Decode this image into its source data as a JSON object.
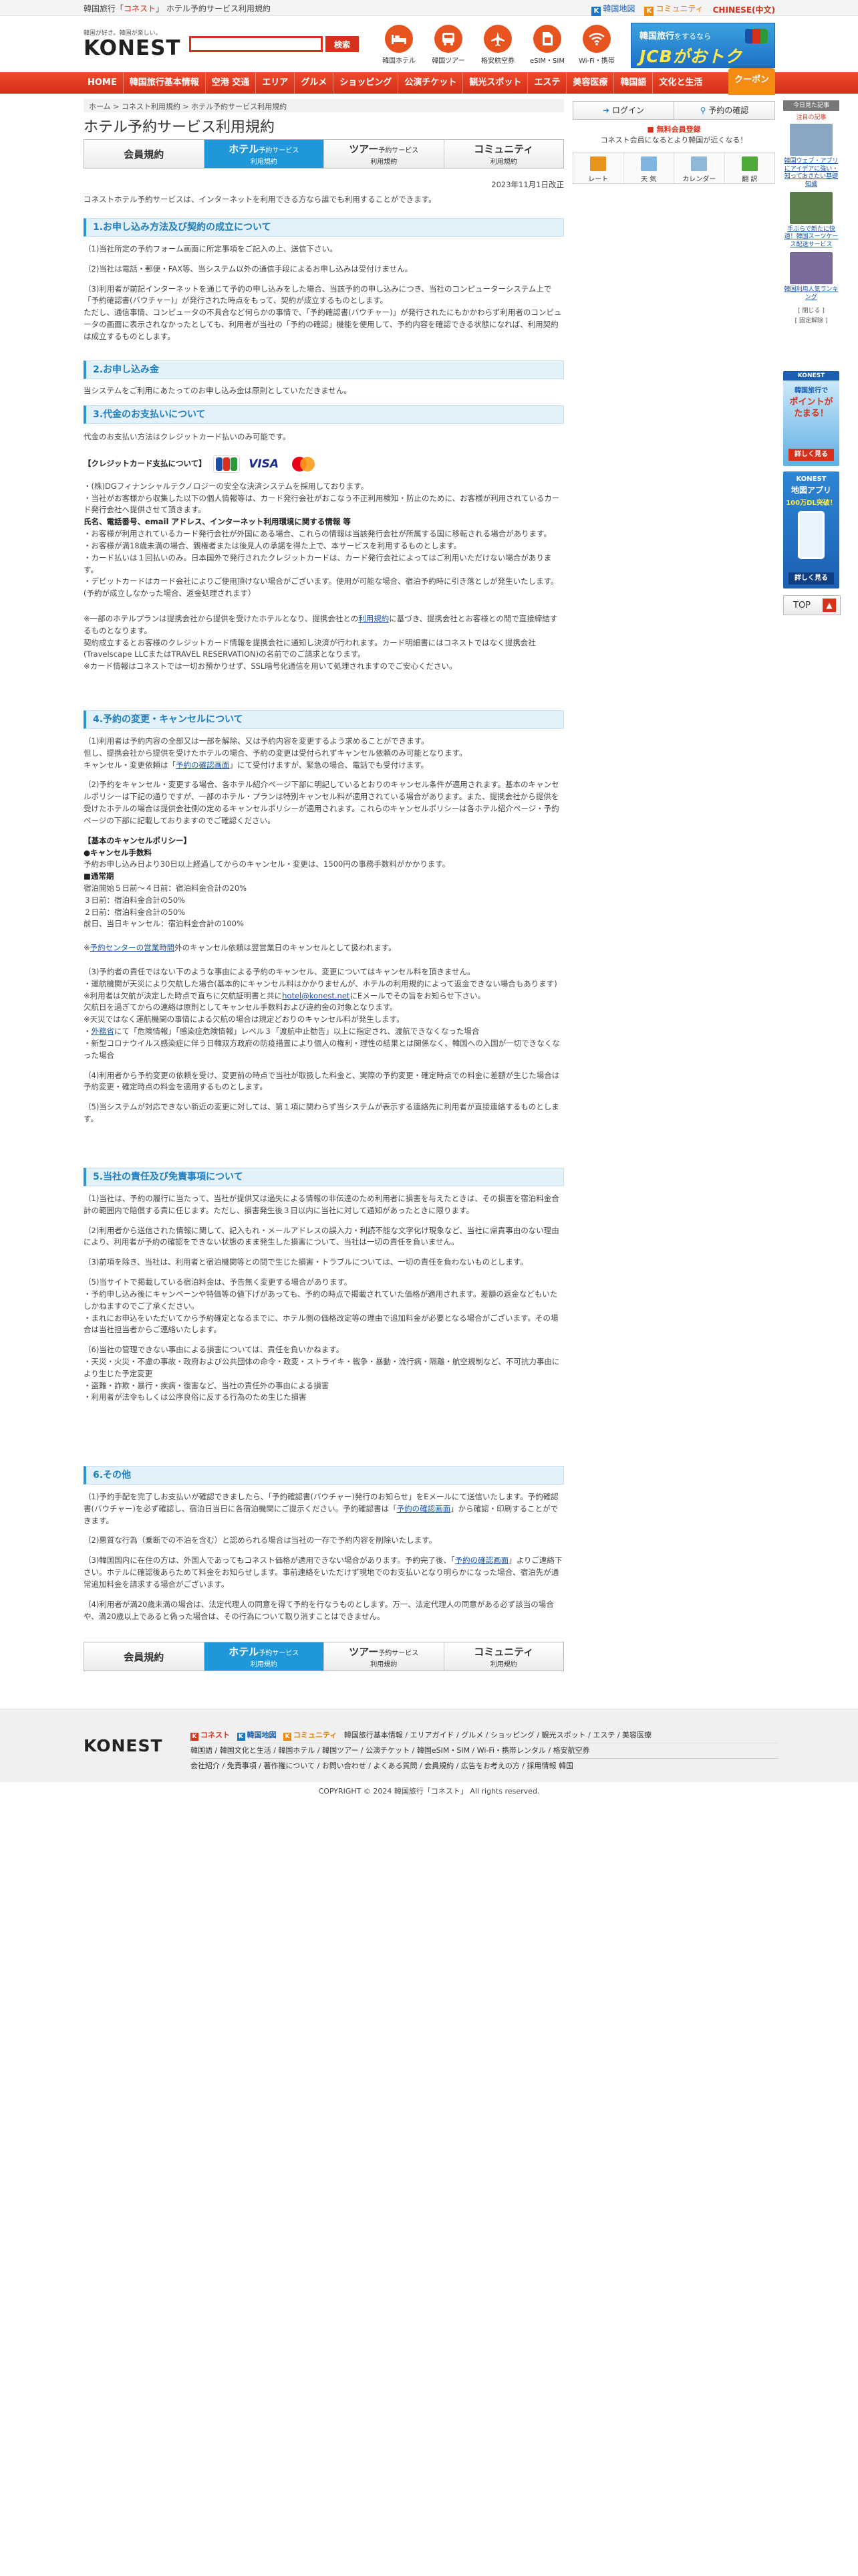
{
  "topbar": {
    "crumb_prefix": "韓国旅行「",
    "crumb_brand": "コネスト",
    "crumb_suffix": "」 ホテル予約サービス利用規約",
    "links": [
      {
        "icon": "map-icon",
        "label": "韓国地図"
      },
      {
        "icon": "community-icon",
        "label": "コミュニティ"
      },
      {
        "icon": "",
        "label": "CHINESE(中文)"
      }
    ]
  },
  "header": {
    "logo_tagline": "韓国が好き。韓国が楽しい。",
    "logo": "KONEST",
    "search_placeholder": "",
    "search_button": "検索",
    "icons": [
      {
        "name": "hotel",
        "icon": "bed-icon",
        "label": "韓国ホテル"
      },
      {
        "name": "tour",
        "icon": "bus-icon",
        "label": "韓国ツアー"
      },
      {
        "name": "flight",
        "icon": "airplane-icon",
        "label": "格安航空券"
      },
      {
        "name": "esim",
        "icon": "sim-icon",
        "label": "eSIM・SIM"
      },
      {
        "name": "wifi",
        "icon": "wifi-icon",
        "label": "Wi-Fi・携帯"
      }
    ],
    "banner": {
      "line1": "韓国旅行",
      "line1_small": "をするなら",
      "line2": "JCBがおトク"
    }
  },
  "nav": {
    "items": [
      "HOME",
      "韓国旅行基本情報",
      "空港 交通",
      "エリア",
      "グルメ",
      "ショッピング",
      "公演チケット",
      "観光スポット",
      "エステ",
      "美容医療",
      "韓国語",
      "文化と生活"
    ],
    "coupon": "クーポン"
  },
  "breadcrumb": "ホーム > コネスト利用規約 > ホテル予約サービス利用規約",
  "page_title": "ホテル予約サービス利用規約",
  "tabs": [
    {
      "big": "会員規約",
      "sm": ""
    },
    {
      "big": "ホテル",
      "big_suffix": "予約サービス",
      "sm": "利用規約"
    },
    {
      "big": "ツアー",
      "big_suffix": "予約サービス",
      "sm": "利用規約"
    },
    {
      "big": "コミュニティ",
      "big_suffix": "",
      "sm": "利用規約"
    }
  ],
  "right_panel": {
    "login": "ログイン",
    "reservation_check": "予約の確認",
    "register": "■ 無料会員登録",
    "register_sub": "コネスト会員になるとより韓国が近くなる！",
    "utils": [
      {
        "icon": "won-icon",
        "label": "レート",
        "color": "#e8941a"
      },
      {
        "icon": "weather-icon",
        "label": "天 気",
        "color": "#7fb5e0"
      },
      {
        "icon": "calendar-icon",
        "label": "カレンダー",
        "color": "#8fb8d8"
      },
      {
        "icon": "translate-icon",
        "label": "翻 訳",
        "color": "#4faa3a"
      }
    ]
  },
  "ads": {
    "head": "今日見た記事",
    "sub": "注目の記事",
    "items": [
      {
        "text": "韓国ウェブ・アプリにアイデアに強い・知っておきたい基礎知識",
        "color": "#8aa6c2"
      },
      {
        "text": "手ぶらで新たに快適！韓国スーツケース配送サービス",
        "color": "#5a7b4a"
      },
      {
        "text": "韓国利用人気ランキング",
        "color": "#7a6a9a"
      }
    ],
    "close1": "[ 閉じる ]",
    "fixed": "[ 固定解除 ]",
    "banner1_l1": "KONEST",
    "banner1_l2": "韓国旅行で",
    "banner1_l3": "ポイントがたまる！",
    "banner1_btn": "詳しく見る",
    "banner2_l1": "KONEST",
    "banner2_l2": "地図アプリ",
    "banner2_l3": "100万DL突破！",
    "banner2_btn": "詳しく見る",
    "top": "TOP"
  },
  "content": {
    "date": "2023年11月1日改正",
    "intro": "コネストホテル予約サービスは、インターネットを利用できる方なら誰でも利用することができます。",
    "s1_title": "1.お申し込み方法及び契約の成立について",
    "s1_p1": "（1)当社所定の予約フォーム画面に所定事項をご記入の上、送信下さい。",
    "s1_p2": "（2)当社は電話・郵便・FAX等、当システム以外の通信手段によるお申し込みは受付けません。",
    "s1_p3a": "（3)利用者が前記インターネットを通じて予約の申し込みをした場合、当該予約の申し込みにつき、当社のコンピューターシステム上で「予約確認書(バウチャー)」が発行された時点をもって、契約が成立するものとします。",
    "s1_p3b": "ただし、通信事情、コンピュータの不具合など何らかの事情で、「予約確認書(バウチャー)」が発行されたにもかかわらず利用者のコンピュータの画面に表示されなかったとしても、利用者が当社の「予約の確認」機能を使用して、予約内容を確認できる状態になれば、利用契約は成立するものとします。",
    "s2_title": "2.お申し込み金",
    "s2_p1": "当システムをご利用にあたってのお申し込み金は原則としていただきません。",
    "s3_title": "3.代金のお支払いについて",
    "s3_p1": "代金のお支払い方法はクレジットカード払いのみ可能です。",
    "s3_cards_label": "【クレジットカード支払について】",
    "s3_l1": "・(株)DGフィナンシャルテクノロジーの安全な決済システムを採用しております。",
    "s3_l2": "・当社がお客様から収集した以下の個人情報等は、カード発行会社がおこなう不正利用検知・防止のために、お客様が利用されているカード発行会社へ提供させて頂きます。",
    "s3_l3": "氏名、電話番号、email アドレス、インターネット利用環境に関する情報 等",
    "s3_l4": "・お客様が利用されているカード発行会社が外国にある場合、これらの情報は当該発行会社が所属する国に移転される場合があります。",
    "s3_l5": "・お客様が満18歳未満の場合、親権者または後見人の承諾を得た上で、本サービスを利用するものとします。",
    "s3_l6": "・カード払いは１回払いのみ。日本国外で発行されたクレジットカードは、カード発行会社によってはご利用いただけない場合があります。",
    "s3_l7": "・デビットカードはカード会社によりご使用頂けない場合がございます。使用が可能な場合、宿泊予約時に引き落としが発生いたします。(予約が成立しなかった場合、返金処理されます）",
    "s3_l8a": "※一部のホテルプランは提携会社から提供を受けたホテルとなり、提携会社との",
    "s3_l8_link": "利用規約",
    "s3_l8b": "に基づき、提携会社とお客様との間で直接締結するものとなります。",
    "s3_l9": "契約成立するとお客様のクレジットカード情報を提携会社に通知し決済が行われます。カード明細書にはコネストではなく提携会社(Travelscape LLCまたはTRAVEL RESERVATION)の名前でのご請求となります。",
    "s3_l10": "※カード情報はコネストでは一切お預かりせず、SSL暗号化通信を用いて処理されますのでご安心ください。",
    "s4_title": "4.予約の変更・キャンセルについて",
    "s4_p1a": "（1)利用者は予約内容の全部又は一部を解除、又は予約内容を変更するよう求めることができます。",
    "s4_p1b": "但し、提携会社から提供を受けたホテルの場合、予約の変更は受付られずキャンセル依頼のみ可能となります。",
    "s4_p1c_pre": "キャンセル・変更依頼は「",
    "s4_p1c_link": "予約の確認画面",
    "s4_p1c_post": "」にて受付けますが、緊急の場合、電話でも受付けます。",
    "s4_p2": "（2)予約をキャンセル・変更する場合、各ホテル紹介ページ下部に明記しているとおりのキャンセル条件が適用されます。基本のキャンセルポリシーは下記の通りですが、一部のホテル・プランは特別キャンセル料が適用されている場合があります。また、提携会社から提供を受けたホテルの場合は提供会社側の定めるキャンセルポリシーが適用されます。これらのキャンセルポリシーは各ホテル紹介ページ・予約ページの下部に記載しておりますのでご確認ください。",
    "s4_basic_title": "【基本のキャンセルポリシー】",
    "s4_cf_title": "●キャンセル手数料",
    "s4_cf_text": "予約お申し込み日より30日以上経過してからのキャンセル・変更は、1500円の事務手数料がかかります。",
    "s4_ns_title": "■通常期",
    "s4_ns_1": "宿泊開始５日前～４日前：宿泊料金合計の20%",
    "s4_ns_2": "３日前：宿泊料金合計の50%",
    "s4_ns_3": "２日前：宿泊料金合計の50%",
    "s4_ns_4": "前日、当日キャンセル：宿泊料金合計の100%",
    "s4_ct_link": "予約センターの営業時間",
    "s4_ct_post": "外のキャンセル依頼は翌営業日のキャンセルとして扱われます。",
    "s4_p3a": "（3)予約者の責任ではない下のような事由による予約のキャンセル、変更についてはキャンセル料を頂きません。",
    "s4_p3b": "・運航機関が天災により欠航した場合(基本的にキャンセル料はかかりませんが、ホテルの利用規約によって返金できない場合もあります)",
    "s4_p3c_pre": "※利用者は欠航が決定した時点で直ちに欠航証明書と共に",
    "s4_p3c_link": "hotel@konest.net",
    "s4_p3c_post": "にEメールでその旨をお知らせ下さい。",
    "s4_p3d": "欠航日を過ぎてからの連絡は原則としてキャンセル手数料および違約金の対象となります。",
    "s4_p3e": "※天災ではなく運航機関の事情による欠航の場合は規定どおりのキャンセル料が発生します。",
    "s4_p3f_link": "外務省",
    "s4_p3f_post": "にて「危険情報」「感染症危険情報」レベル３「渡航中止勧告」以上に指定され、渡航できなくなった場合",
    "s4_p3g": "・新型コロナウイルス感染症に伴う日韓双方政府の防疫措置により個人の権利・理性の結果とは関係なく、韓国への入国が一切できなくなった場合",
    "s4_p4": "（4)利用者から予約変更の依頼を受け、変更前の時点で当社が取扱した料金と、実際の予約変更・確定時点での料金に差額が生じた場合は予約変更・確定時点の料金を適用するものとします。",
    "s4_p5": "（5)当システムが対応できない新近の変更に対しては、第１項に関わらず当システムが表示する連絡先に利用者が直接連絡するものとします。",
    "s5_title": "5.当社の責任及び免責事項について",
    "s5_p1": "（1)当社は、予約の履行に当たって、当社が提供又は過失による情報の非伝達のため利用者に損害を与えたときは、その損害を宿泊料金合計の範囲内で賠償する責に任じます。ただし、損害発生後３日以内に当社に対して通知があったときに限ります。",
    "s5_p2": "（2)利用者から送信された情報に関して、記入もれ・メールアドレスの誤入力・利読不能な文字化け現象など、当社に帰責事由のない理由により、利用者が予約の確認をできない状態のまま発生した損害について、当社は一切の責任を負いません。",
    "s5_p3": "（3)前項を除き、当社は、利用者と宿泊機関等との間で生じた損害・トラブルについては、一切の責任を負わないものとします。",
    "s5_p4a": "（5)当サイトで掲載している宿泊料金は、予告無く変更する場合があります。",
    "s5_p4b": "・予約申し込み後にキャンペーンや特価等の値下げがあっても、予約の時点で掲載されていた価格が適用されます。差額の返金などもいたしかねますのでご了承ください。",
    "s5_p4c": "・まれにお申込をいただいてから予約確定となるまでに、ホテル側の価格改定等の理由で追加料金が必要となる場合がございます。その場合は当社担当者からご連絡いたします。",
    "s5_p5a": "（6)当社の管理できない事由による損害については、責任を負いかねます。",
    "s5_p5b": "・天災・火災・不慮の事故・政府および公共団体の命令・政変・ストライキ・戦争・暴動・流行病・隔離・航空規制など、不可抗力事由により生じた予定変更",
    "s5_p5c": "・盗難・詐欺・暴行・疾病・復害など、当社の責任外の事由による損害",
    "s5_p5d": "・利用者が法令もしくは公序良俗に反する行為のため生じた損害",
    "s6_title": "6.その他",
    "s6_p1_pre": "（1)予約手配を完了しお支払いが確認できましたら、「予約確認書(バウチャー)発行のお知らせ」をEメールにて送信いたします。予約確認書(バウチャー)を必ず確認し、宿泊日当日に各宿泊機関にご提示ください。予約確認書は「",
    "s6_p1_link": "予約の確認画面",
    "s6_p1_post": "」から確認・印刷することができます。",
    "s6_p2": "（2)悪質な行為（乗断での不泊を含む）と認められる場合は当社の一存で予約内容を削除いたします。",
    "s6_p3_pre": "（3)韓国国内に在住の方は、外国人であってもコネスト価格が適用できない場合があります。予約完了後、「",
    "s6_p3_link": "予約の確認画面",
    "s6_p3_post": "」よりご連絡下さい。ホテルに確認後あらためて料金をお知らせします。事前連絡をいただけず現地でのお支払いとなり明らかになった場合、宿泊先が通常追加料金を請求する場合がございます。",
    "s6_p4": "（4)利用者が満20歳未満の場合は、法定代理人の同意を得て予約を行なうものとします。万一、法定代理人の同意がある必ず該当の場合や、満20歳以上であると偽った場合は、その行為について取り消すことはできません。"
  },
  "footer": {
    "logo": "KONEST",
    "row1_icons": [
      {
        "icon": "konest-icon",
        "label": "コネスト",
        "color": "#d9301c"
      },
      {
        "icon": "map-icon",
        "label": "韓国地図",
        "color": "#1a78c8"
      },
      {
        "icon": "community-icon",
        "label": "コミュニティ",
        "color": "#ef8a0a"
      }
    ],
    "row1_links": "韓国旅行基本情報 / エリアガイド / グルメ / ショッピング / 観光スポット / エステ / 美容医療",
    "row2_links": "韓国語 / 韓国文化と生活 / 韓国ホテル / 韓国ツアー / 公演チケット / 韓国eSIM・SIM / Wi-Fi・携帯レンタル / 格安航空券",
    "row3_links": "会社紹介 / 免責事項 / 著作権について / お問い合わせ / よくある質問 / 会員規約 / 広告をお考えの方 / 採用情報 韓国",
    "copyright": "COPYRIGHT © 2024 韓国旅行「コネスト」 All rights reserved."
  }
}
